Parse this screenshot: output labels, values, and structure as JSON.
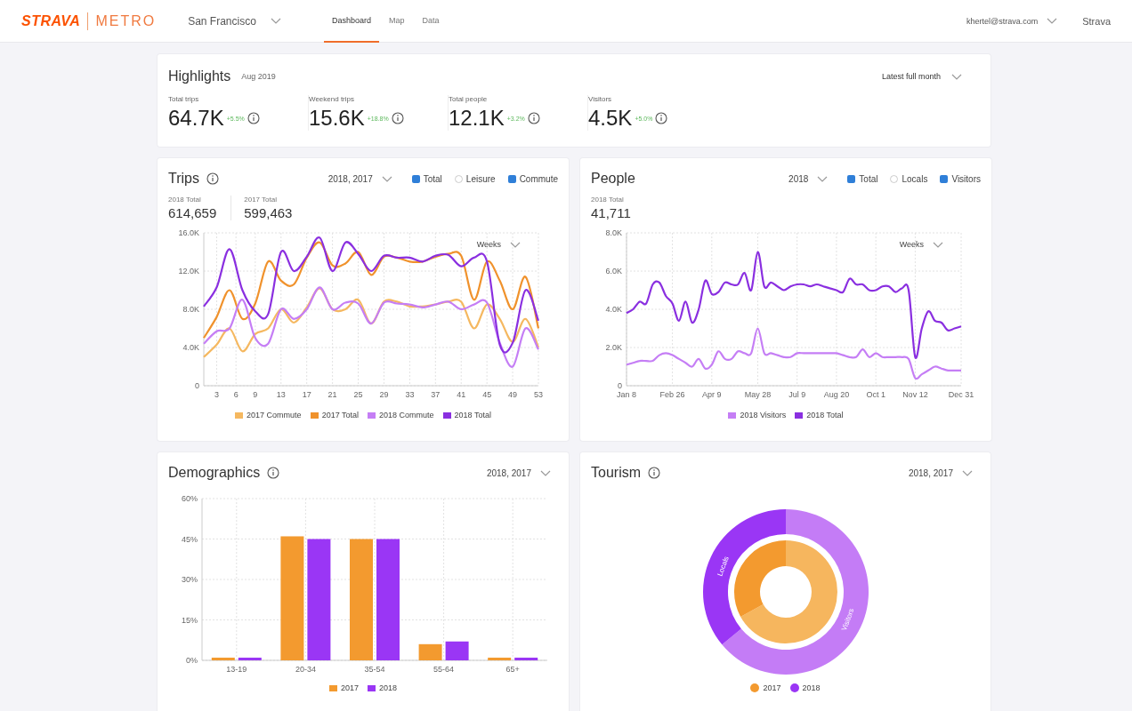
{
  "header": {
    "logo": "STRAVA",
    "product": "METRO",
    "city": "San Francisco",
    "tabs": [
      {
        "label": "Dashboard",
        "selected": true
      },
      {
        "label": "Map",
        "selected": false
      },
      {
        "label": "Data",
        "selected": false
      }
    ],
    "account": "khertel@strava.com",
    "app_link": "Strava"
  },
  "highlights": {
    "title": "Highlights",
    "period": "Aug 2019",
    "range": "Latest full month",
    "metrics": [
      {
        "label": "Total trips",
        "value": "64.7K",
        "change": "+5.5%"
      },
      {
        "label": "Weekend trips",
        "value": "15.6K",
        "change": "+18.8%"
      },
      {
        "label": "Total people",
        "value": "12.1K",
        "change": "+3.2%"
      },
      {
        "label": "Visitors",
        "value": "4.5K",
        "change": "+5.0%"
      }
    ]
  },
  "trips": {
    "title": "Trips",
    "info": true,
    "filter": "2018, 2017",
    "toggles": [
      {
        "label": "Total",
        "checked": true
      },
      {
        "label": "Leisure",
        "checked": false
      },
      {
        "label": "Commute",
        "checked": true
      }
    ],
    "totals": [
      {
        "label": "2018 Total",
        "value": "614,659"
      },
      {
        "label": "2017 Total",
        "value": "599,463"
      }
    ],
    "interval": "Weeks",
    "chart_data": {
      "type": "line",
      "grid": true,
      "x": [
        1,
        3,
        5,
        7,
        9,
        11,
        13,
        15,
        17,
        19,
        21,
        23,
        25,
        27,
        29,
        31,
        33,
        35,
        37,
        39,
        41,
        43,
        45,
        47,
        49,
        51,
        53
      ],
      "xlim": [
        1,
        53
      ],
      "ylim": [
        0,
        16
      ],
      "xticks": [
        3,
        6,
        9,
        13,
        17,
        21,
        25,
        29,
        33,
        37,
        41,
        45,
        49,
        53
      ],
      "yticks": [
        {
          "value": 0,
          "label": "0"
        },
        {
          "value": 4,
          "label": "4.0K"
        },
        {
          "value": 8,
          "label": "8.0K"
        },
        {
          "value": 12,
          "label": "12.0K"
        },
        {
          "value": 16,
          "label": "16.0K"
        }
      ],
      "series": [
        {
          "name": "2017 Commute",
          "color": "#f5b860",
          "values": [
            3,
            4.3,
            6,
            3.6,
            5.4,
            6,
            8,
            6.6,
            8.2,
            10.2,
            8,
            8,
            9,
            6.5,
            8.8,
            8.8,
            8.3,
            8.3,
            8.5,
            8.8,
            8.8,
            6,
            8.5,
            7,
            4.6,
            7,
            4
          ]
        },
        {
          "name": "2017 Total",
          "color": "#f0922c",
          "values": [
            5,
            7.2,
            10,
            7,
            8.6,
            13,
            11,
            10.6,
            13.4,
            15,
            12.6,
            12.8,
            14,
            11.6,
            13.5,
            13.4,
            13,
            13,
            13.5,
            13.8,
            13.6,
            9,
            13,
            11,
            8,
            11.4,
            6
          ]
        },
        {
          "name": "2018 Commute",
          "color": "#c57ef5",
          "values": [
            4.4,
            5.7,
            6,
            9,
            5,
            4.4,
            8,
            7,
            8,
            10.3,
            8,
            8.7,
            8.6,
            6.5,
            8.7,
            8.6,
            8.5,
            8.2,
            8.5,
            8.8,
            8,
            8.5,
            8.7,
            4.5,
            2,
            6,
            3.8
          ]
        },
        {
          "name": "2018 Total",
          "color": "#8a2fe0",
          "values": [
            8.3,
            10.3,
            14.3,
            10,
            7.8,
            7.5,
            14,
            12,
            13.5,
            15.5,
            12,
            15,
            13.8,
            12,
            13.6,
            13.4,
            13.4,
            13,
            13.6,
            13.7,
            12.5,
            13.4,
            13,
            4.3,
            4.5,
            10,
            6.8
          ]
        }
      ]
    }
  },
  "people": {
    "title": "People",
    "info": false,
    "filter": "2018",
    "toggles": [
      {
        "label": "Total",
        "checked": true
      },
      {
        "label": "Locals",
        "checked": false
      },
      {
        "label": "Visitors",
        "checked": true
      }
    ],
    "totals": [
      {
        "label": "2018 Total",
        "value": "41,711"
      }
    ],
    "interval": "Weeks",
    "chart_data": {
      "type": "line",
      "grid": true,
      "categories": [
        "Jan 8",
        null,
        null,
        null,
        null,
        null,
        null,
        "Feb 26",
        null,
        null,
        null,
        null,
        null,
        "Apr 9",
        null,
        null,
        null,
        null,
        null,
        null,
        "May 28",
        null,
        null,
        null,
        null,
        null,
        "Jul 9",
        null,
        null,
        null,
        null,
        null,
        "Aug 20",
        null,
        null,
        null,
        null,
        null,
        "Oct 1",
        null,
        null,
        null,
        null,
        null,
        "Nov 12",
        null,
        null,
        null,
        null,
        null,
        null,
        "Dec 31"
      ],
      "ylim": [
        0,
        8
      ],
      "yticks": [
        {
          "value": 0,
          "label": "0"
        },
        {
          "value": 2,
          "label": "2.0K"
        },
        {
          "value": 4,
          "label": "4.0K"
        },
        {
          "value": 6,
          "label": "6.0K"
        },
        {
          "value": 8,
          "label": "8.0K"
        }
      ],
      "series": [
        {
          "name": "2018 Visitors",
          "color": "#c57ef5",
          "values": [
            1.1,
            1.2,
            1.3,
            1.3,
            1.3,
            1.6,
            1.7,
            1.6,
            1.4,
            1.2,
            1.0,
            1.4,
            0.9,
            1.1,
            1.8,
            1.4,
            1.4,
            1.8,
            1.7,
            1.7,
            3.0,
            1.7,
            1.7,
            1.6,
            1.5,
            1.5,
            1.7,
            1.7,
            1.7,
            1.7,
            1.7,
            1.7,
            1.7,
            1.6,
            1.5,
            1.5,
            1.9,
            1.5,
            1.7,
            1.5,
            1.5,
            1.5,
            1.5,
            1.4,
            0.4,
            0.6,
            0.8,
            1.0,
            0.9,
            0.8,
            0.8,
            0.8
          ]
        },
        {
          "name": "2018 Total",
          "color": "#8a2fe0",
          "values": [
            3.8,
            4.0,
            4.4,
            4.3,
            5.3,
            5.4,
            4.7,
            4.3,
            3.4,
            4.4,
            3.3,
            4.0,
            5.5,
            4.8,
            4.9,
            5.4,
            5.3,
            5.3,
            5.9,
            5.0,
            7.0,
            5.2,
            5.4,
            5.2,
            5.0,
            5.2,
            5.3,
            5.3,
            5.2,
            5.3,
            5.2,
            5.1,
            5.0,
            4.9,
            5.6,
            5.3,
            5.3,
            5.0,
            5.0,
            5.2,
            5.2,
            4.9,
            5.1,
            5.0,
            1.5,
            3.0,
            3.9,
            3.4,
            3.3,
            2.9,
            3.0,
            3.1
          ]
        }
      ]
    }
  },
  "demographics": {
    "title": "Demographics",
    "filter": "2018, 2017",
    "chart_data": {
      "type": "bar",
      "grid": true,
      "categories": [
        "13-19",
        "20-34",
        "35-54",
        "55-64",
        "65+"
      ],
      "ylim": [
        0,
        60
      ],
      "yticks": [
        {
          "value": 0,
          "label": "0%"
        },
        {
          "value": 15,
          "label": "15%"
        },
        {
          "value": 30,
          "label": "30%"
        },
        {
          "value": 45,
          "label": "45%"
        },
        {
          "value": 60,
          "label": "60%"
        }
      ],
      "series": [
        {
          "name": "2017",
          "color": "#f39a2f",
          "values": [
            1,
            46,
            45,
            6,
            1
          ]
        },
        {
          "name": "2018",
          "color": "#9a36f5",
          "values": [
            1,
            45,
            45,
            7,
            1
          ]
        }
      ]
    }
  },
  "tourism": {
    "title": "Tourism",
    "filter": "2018, 2017",
    "ring_labels": [
      "Locals",
      "Visitors"
    ],
    "legend": [
      {
        "label": "2017",
        "color": "#f39a2f"
      },
      {
        "label": "2018",
        "color": "#9a36f5"
      }
    ]
  }
}
